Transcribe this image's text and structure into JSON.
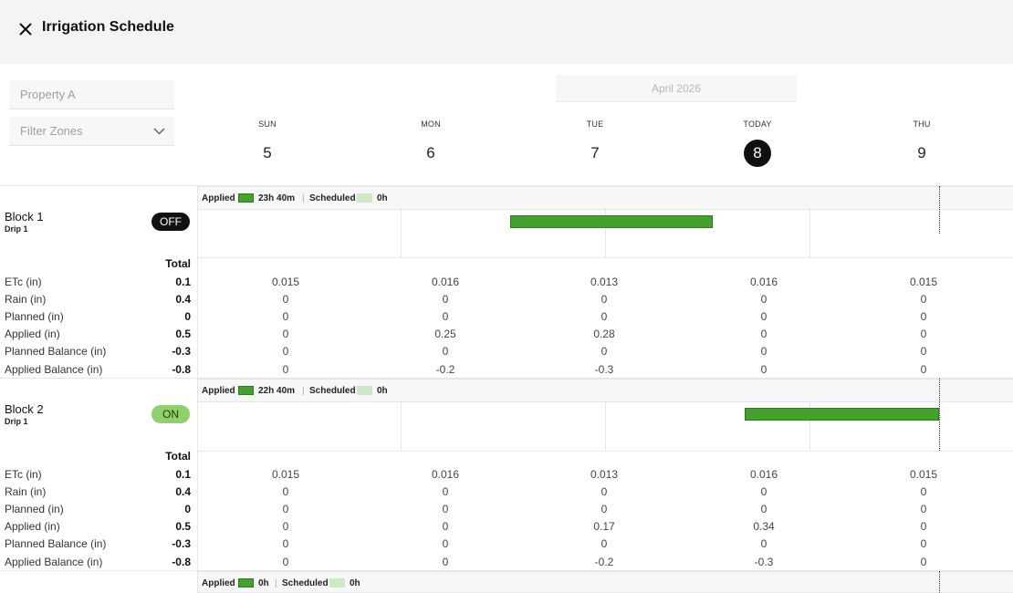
{
  "header": {
    "title": "Irrigation Schedule"
  },
  "controls": {
    "property_placeholder": "Property A",
    "filter_zones_label": "Filter Zones"
  },
  "calendar": {
    "month_label": "April 2026",
    "days": [
      {
        "name": "SUN",
        "num": "5"
      },
      {
        "name": "MON",
        "num": "6"
      },
      {
        "name": "TUE",
        "num": "7"
      },
      {
        "name": "TODAY",
        "num": "8"
      },
      {
        "name": "THU",
        "num": "9"
      }
    ]
  },
  "row_labels": [
    "ETc (in)",
    "Rain (in)",
    "Planned (in)",
    "Applied (in)",
    "Planned Balance (in)",
    "Applied Balance (in)"
  ],
  "total_label": "Total",
  "blocks": [
    {
      "name": "Block 1",
      "sub": "Drip 1",
      "status": "OFF",
      "legend": {
        "applied_label": "Applied",
        "applied_value": "23h 40m",
        "scheduled_label": "Scheduled",
        "scheduled_value": "0h"
      },
      "totals": [
        "0.1",
        "0.4",
        "0",
        "0.5",
        "-0.3",
        "-0.8"
      ],
      "cells": [
        [
          "0.015",
          "0.016",
          "0.013",
          "0.016",
          "0.015"
        ],
        [
          "0",
          "0",
          "0",
          "0",
          "0"
        ],
        [
          "0",
          "0",
          "0",
          "0",
          "0"
        ],
        [
          "0",
          "0.25",
          "0.28",
          "0",
          "0"
        ],
        [
          "0",
          "0",
          "0",
          "0",
          "0"
        ],
        [
          "0",
          "-0.2",
          "-0.3",
          "0",
          "0"
        ]
      ]
    },
    {
      "name": "Block 2",
      "sub": "Drip 1",
      "status": "ON",
      "legend": {
        "applied_label": "Applied",
        "applied_value": "22h 40m",
        "scheduled_label": "Scheduled",
        "scheduled_value": "0h"
      },
      "totals": [
        "0.1",
        "0.4",
        "0",
        "0.5",
        "-0.3",
        "-0.8"
      ],
      "cells": [
        [
          "0.015",
          "0.016",
          "0.013",
          "0.016",
          "0.015"
        ],
        [
          "0",
          "0",
          "0",
          "0",
          "0"
        ],
        [
          "0",
          "0",
          "0",
          "0",
          "0"
        ],
        [
          "0",
          "0",
          "0.17",
          "0.34",
          "0"
        ],
        [
          "0",
          "0",
          "0",
          "0",
          "0"
        ],
        [
          "0",
          "0",
          "-0.2",
          "-0.3",
          "0"
        ]
      ]
    },
    {
      "legend": {
        "applied_label": "Applied",
        "applied_value": "0h",
        "scheduled_label": "Scheduled",
        "scheduled_value": "0h"
      }
    }
  ],
  "colors": {
    "applied": "#43a22e",
    "scheduled": "#cfe9c7",
    "on_pill": "#8fd16a",
    "off_pill": "#111111"
  },
  "icons": {
    "close": "close-icon",
    "filter_chevron": "chevron-down-icon"
  }
}
